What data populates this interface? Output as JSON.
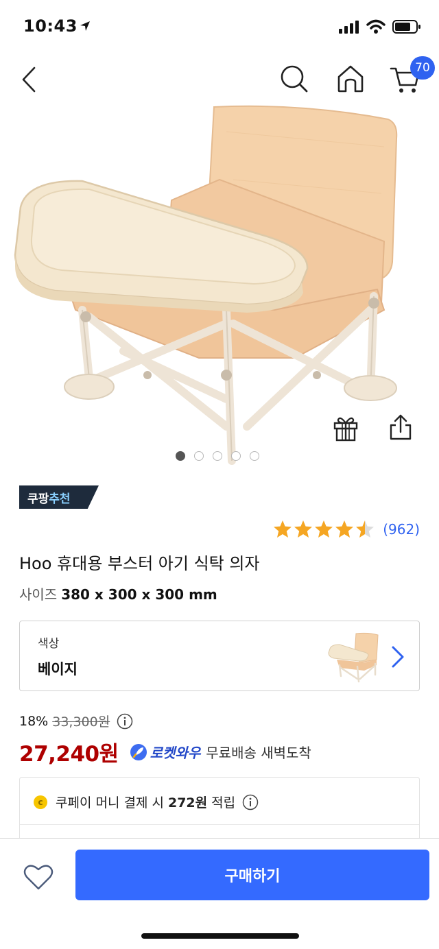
{
  "status_bar": {
    "time": "10:43"
  },
  "nav": {
    "cart_count": "70"
  },
  "colors": {
    "brand_blue": "#346aff",
    "price_red": "#ae0000",
    "rating_gold": "#f5a623",
    "badge_bg": "#1e2b3c"
  },
  "gallery": {
    "image_icon": "product-photo-booster-chair",
    "dot_count": 5,
    "active_dot": 0
  },
  "badge": {
    "part1": "쿠팡",
    "part2": "추천"
  },
  "rating": {
    "stars": 4.5,
    "count": "(962)"
  },
  "product": {
    "title": "Hoo 휴대용 부스터 아기 식탁 의자",
    "size_label": "사이즈",
    "size_value": "380 x 300 x 300 mm"
  },
  "option": {
    "label": "색상",
    "value": "베이지"
  },
  "pricing": {
    "discount_rate": "18%",
    "original_price": "33,300원",
    "sale_price": "27,240원",
    "rocket_label": "로켓와우",
    "delivery_text": "무료배송 새벽도착"
  },
  "cashback": {
    "coin": "c",
    "prefix": "쿠페이 머니 결제 시",
    "amount": "272원",
    "suffix": "적립"
  },
  "bottom": {
    "buy_label": "구매하기"
  }
}
